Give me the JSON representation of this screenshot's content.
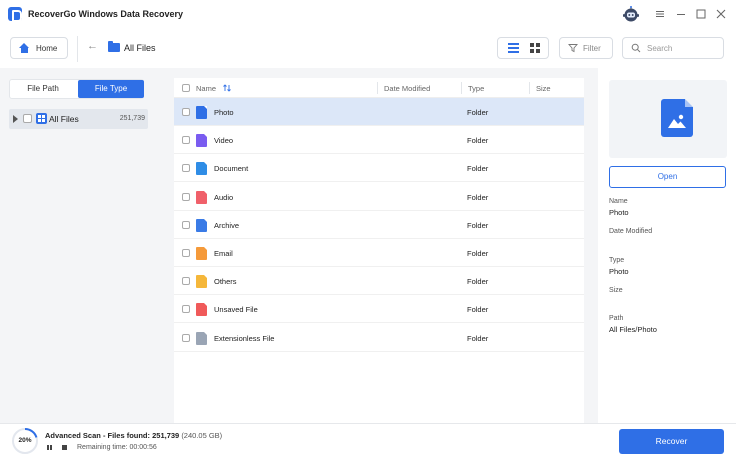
{
  "app": {
    "title": "RecoverGo Windows Data Recovery"
  },
  "window_controls": [
    "menu-icon",
    "minimize-icon",
    "maximize-icon",
    "close-icon"
  ],
  "toolbar": {
    "home_label": "Home",
    "breadcrumb": "All Files",
    "filter_label": "Filter",
    "search_placeholder": "Search"
  },
  "sidebar": {
    "tabs": [
      {
        "label": "File Path",
        "active": false
      },
      {
        "label": "File Type",
        "active": true
      }
    ],
    "tree": [
      {
        "label": "All Files",
        "count": "251,739",
        "icon": "grid-icon"
      }
    ]
  },
  "file_list": {
    "columns": [
      "Name",
      "Date Modified",
      "Type",
      "Size"
    ],
    "rows": [
      {
        "name": "Photo",
        "date_modified": "",
        "type": "Folder",
        "size": "",
        "icon": "photo-icon",
        "color": "#2f6fe6",
        "selected": true
      },
      {
        "name": "Video",
        "date_modified": "",
        "type": "Folder",
        "size": "",
        "icon": "video-icon",
        "color": "#7a5cf0",
        "selected": false
      },
      {
        "name": "Document",
        "date_modified": "",
        "type": "Folder",
        "size": "",
        "icon": "document-icon",
        "color": "#2f8de6",
        "selected": false
      },
      {
        "name": "Audio",
        "date_modified": "",
        "type": "Folder",
        "size": "",
        "icon": "audio-icon",
        "color": "#f0606a",
        "selected": false
      },
      {
        "name": "Archive",
        "date_modified": "",
        "type": "Folder",
        "size": "",
        "icon": "archive-icon",
        "color": "#3a7be6",
        "selected": false
      },
      {
        "name": "Email",
        "date_modified": "",
        "type": "Folder",
        "size": "",
        "icon": "email-icon",
        "color": "#f59a3a",
        "selected": false
      },
      {
        "name": "Others",
        "date_modified": "",
        "type": "Folder",
        "size": "",
        "icon": "folder-icon",
        "color": "#f5b73a",
        "selected": false
      },
      {
        "name": "Unsaved File",
        "date_modified": "",
        "type": "Folder",
        "size": "",
        "icon": "unsaved-file-icon",
        "color": "#f05a5a",
        "selected": false
      },
      {
        "name": "Extensionless File",
        "date_modified": "",
        "type": "Folder",
        "size": "",
        "icon": "extensionless-file-icon",
        "color": "#9aa5b5",
        "selected": false
      }
    ]
  },
  "details": {
    "open_label": "Open",
    "properties": [
      {
        "label": "Name",
        "value": "Photo"
      },
      {
        "label": "Date Modified",
        "value": ""
      },
      {
        "label": "Type",
        "value": "Photo"
      },
      {
        "label": "Size",
        "value": ""
      },
      {
        "label": "Path",
        "value": "All Files/Photo"
      }
    ]
  },
  "status": {
    "progress_percent": 20,
    "progress_text": "20%",
    "scan_label": "Advanced Scan - Files found: 251,739",
    "scan_size": "(240.05 GB)",
    "remaining": "Remaining time: 00:00:56",
    "recover_label": "Recover"
  },
  "colors": {
    "accent": "#2f6fe6",
    "selected_row": "#dce7f8",
    "panel_bg": "#f4f5f7"
  }
}
